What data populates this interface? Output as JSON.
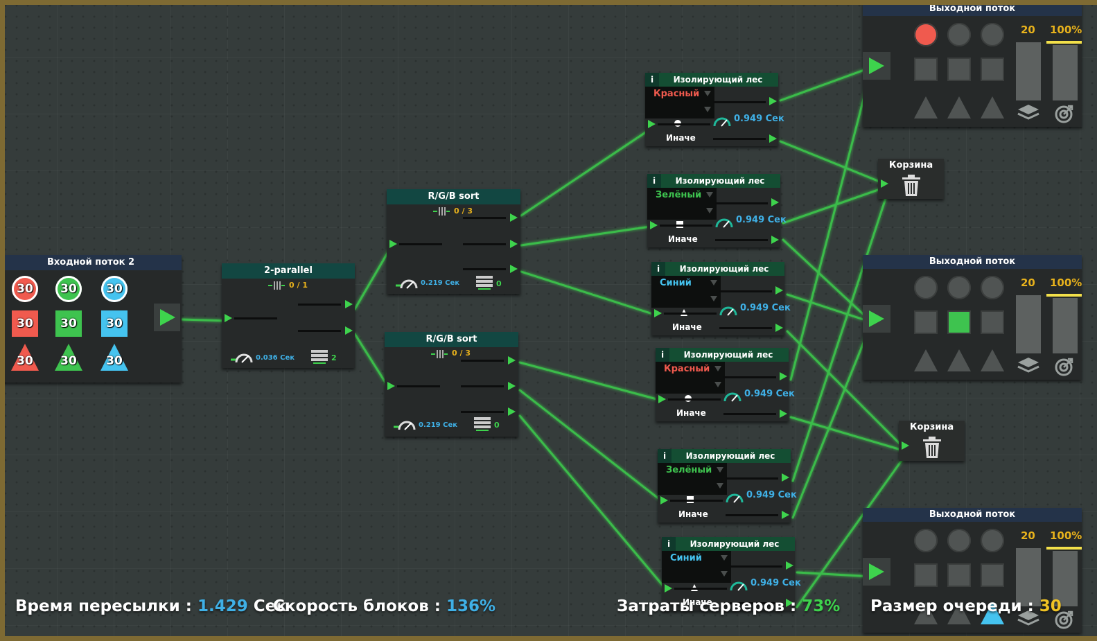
{
  "colors": {
    "accent_green": "#3ed34d",
    "value_blue": "#3fb0e6",
    "count_yellow": "#e8b21c",
    "red": "#f05a4e",
    "green": "#3ec34f",
    "blue": "#45c3ef",
    "frame": "#7e6a33"
  },
  "input": {
    "title": "Входной поток 2",
    "badges": [
      [
        "30",
        "30",
        "30"
      ],
      [
        "30",
        "30",
        "30"
      ],
      [
        "30",
        "30",
        "30"
      ]
    ]
  },
  "parallel": {
    "title": "2-parallel",
    "count": "0 / 1",
    "time": "0.036 Сек",
    "servers": "2"
  },
  "sort1": {
    "title": "R/G/B sort",
    "count": "0 / 3",
    "time": "0.219 Сек",
    "servers": "0"
  },
  "sort2": {
    "title": "R/G/B sort",
    "count": "0 / 3",
    "time": "0.219 Сек",
    "servers": "0"
  },
  "filters": [
    {
      "info": "i",
      "title": "Изолирующий лес",
      "option": "Красный",
      "option_color": "#f05a4e",
      "shape": "circle",
      "time": "0.949 Сек",
      "otherwise": "Иначе"
    },
    {
      "info": "i",
      "title": "Изолирующий лес",
      "option": "Зелёный",
      "option_color": "#3ec34f",
      "shape": "square",
      "time": "0.949 Сек",
      "otherwise": "Иначе"
    },
    {
      "info": "i",
      "title": "Изолирующий лес",
      "option": "Синий",
      "option_color": "#45c3ef",
      "shape": "triangle",
      "time": "0.949 Сек",
      "otherwise": "Иначе"
    },
    {
      "info": "i",
      "title": "Изолирующий лес",
      "option": "Красный",
      "option_color": "#f05a4e",
      "shape": "circle",
      "time": "0.949 Сек",
      "otherwise": "Иначе"
    },
    {
      "info": "i",
      "title": "Изолирующий лес",
      "option": "Зелёный",
      "option_color": "#3ec34f",
      "shape": "square",
      "time": "0.949 Сек",
      "otherwise": "Иначе"
    },
    {
      "info": "i",
      "title": "Изолирующий лес",
      "option": "Синий",
      "option_color": "#45c3ef",
      "shape": "triangle",
      "time": "0.949 Сек",
      "otherwise": "Иначе"
    }
  ],
  "outputs": [
    {
      "title": "Выходной поток",
      "count": "20",
      "percent": "100%",
      "lit": "circle-1"
    },
    {
      "title": "Выходной поток",
      "count": "20",
      "percent": "100%",
      "lit": "square-2"
    },
    {
      "title": "Выходной поток",
      "count": "20",
      "percent": "100%",
      "lit": "triangle-3"
    }
  ],
  "trash": [
    {
      "title": "Корзина"
    },
    {
      "title": "Корзина"
    }
  ],
  "stats": {
    "latency_label": "Время пересылки :",
    "latency_value": "1.429",
    "latency_unit": "Сек",
    "speed_label": "Скорость блоков :",
    "speed_value": "136%",
    "cost_label": "Затраты серверов :",
    "cost_value": "73%",
    "queue_label": "Размер очереди :",
    "queue_value": "30"
  }
}
